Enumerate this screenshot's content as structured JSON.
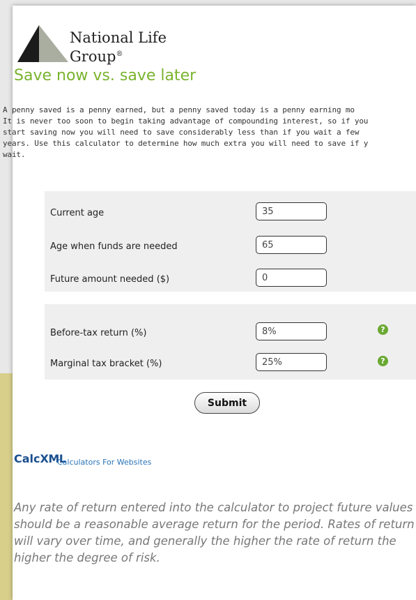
{
  "brand": {
    "name_line1": "National Life",
    "name_line2": "Group",
    "reg": "®"
  },
  "title": "Save now vs. save later",
  "intro_lines": [
    "A penny saved is a penny earned, but a penny saved today is a penny earning mo",
    "It is never too soon to begin taking advantage of compounding interest, so if you",
    "start saving now you will need to save considerably less than if you wait a few",
    "years. Use this calculator to determine how much extra you will need to save if y",
    "wait."
  ],
  "form": {
    "current_age": {
      "label": "Current age",
      "value": "35"
    },
    "age_needed": {
      "label": "Age when funds are needed",
      "value": "65"
    },
    "future_amount": {
      "label": "Future amount needed ($)",
      "value": "0"
    },
    "before_tax": {
      "label": "Before-tax return (%)",
      "value": "8%",
      "help": "?"
    },
    "tax_bracket": {
      "label": "Marginal tax bracket (%)",
      "value": "25%",
      "help": "?"
    }
  },
  "submit_label": "Submit",
  "calcxml": {
    "logo_calc": "Calc",
    "logo_xml": "XML",
    "link": "Calculators For Websites"
  },
  "disclaimer": "Any rate of return entered into the calculator to project future values should be a reasonable average return for the period. Rates of return will vary over time, and generally the higher the rate of return the higher the degree of risk."
}
